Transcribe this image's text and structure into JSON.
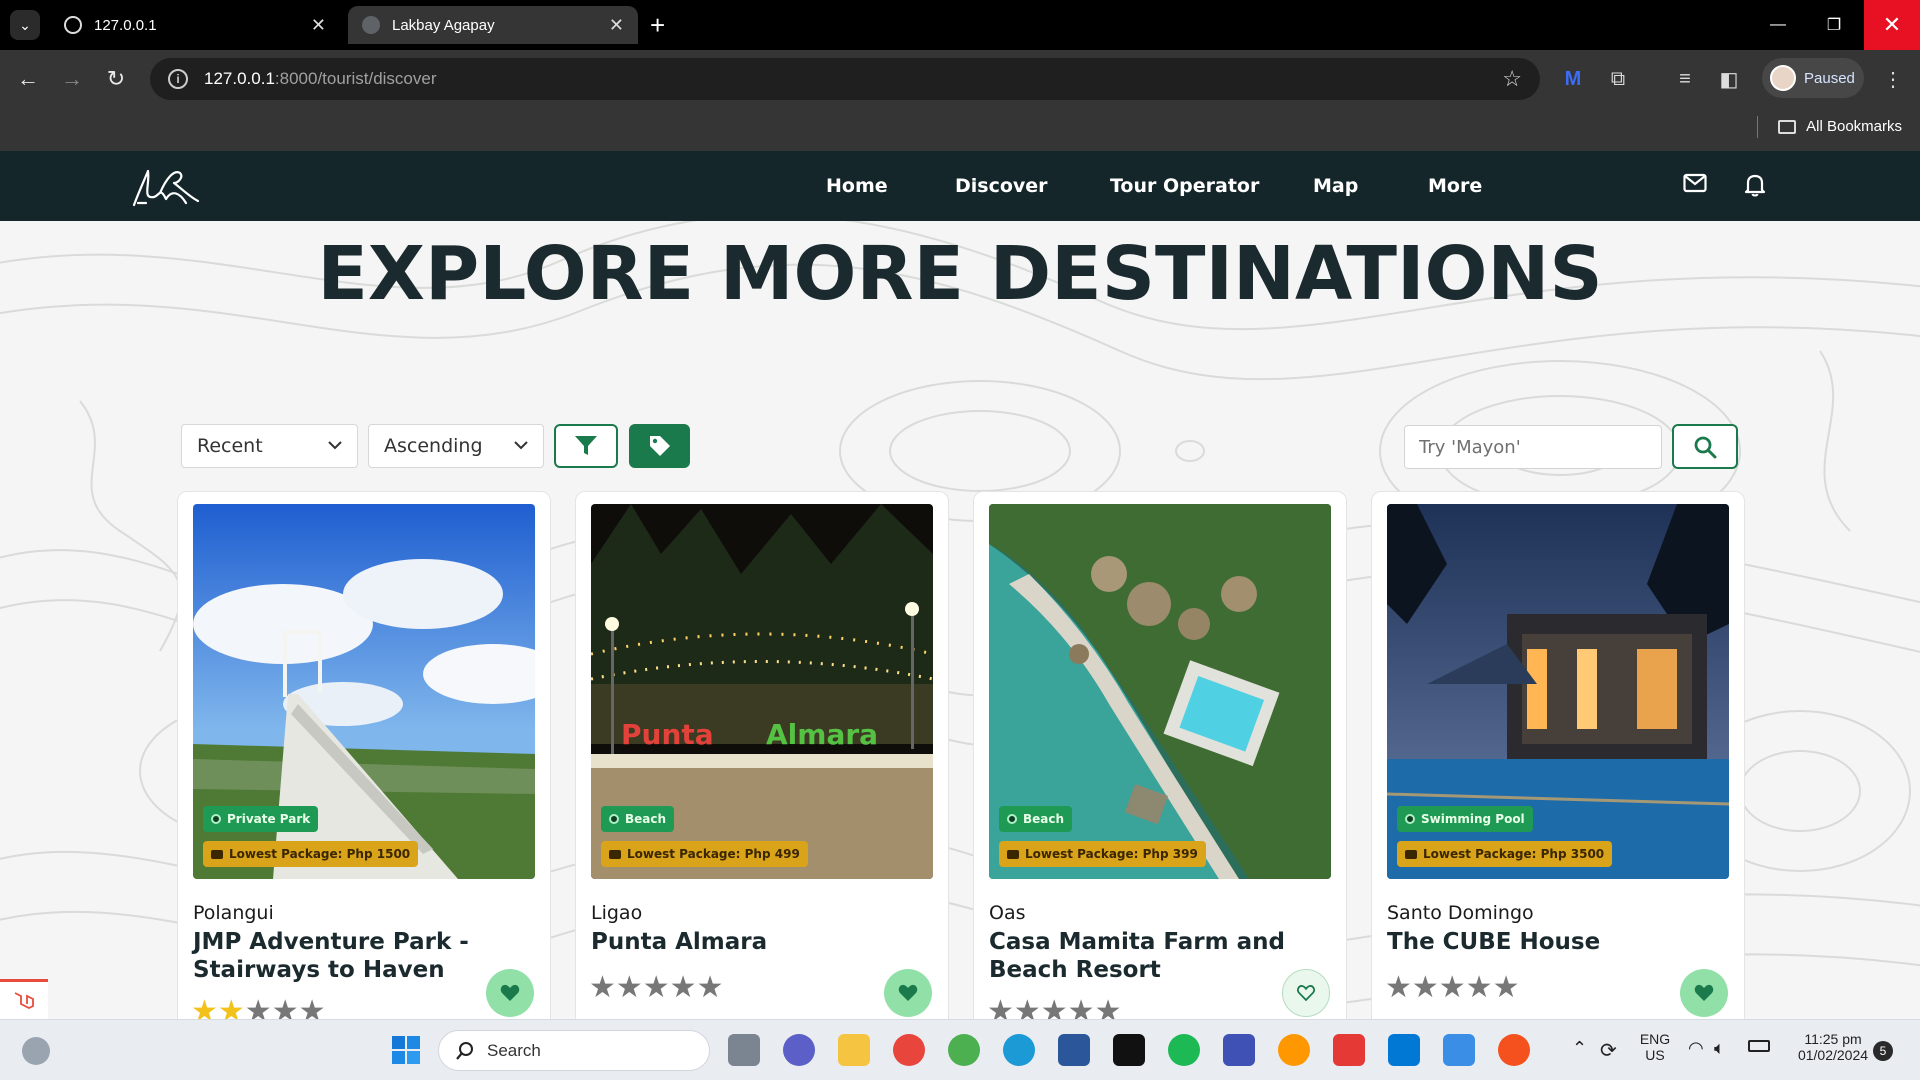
{
  "browser": {
    "tabs": [
      {
        "title": "127.0.0.1",
        "active": false
      },
      {
        "title": "Lakbay Agapay",
        "active": true
      }
    ],
    "url_host": "127.0.0.1",
    "url_path": ":8000/tourist/discover",
    "profile_label": "Paused",
    "bookmarks_label": "All Bookmarks"
  },
  "site": {
    "nav": [
      "Home",
      "Discover",
      "Tour Operator",
      "Map",
      "More"
    ],
    "hero_title": "EXPLORE MORE DESTINATIONS",
    "sort_field": "Recent",
    "sort_order": "Ascending",
    "search_placeholder": "Try 'Mayon'",
    "accent": "#1b7a4c",
    "nav_bg": "#15262a"
  },
  "cards": [
    {
      "town": "Polangui",
      "name": "JMP Adventure Park - Stairways to Haven",
      "category": "Private Park",
      "price": "Lowest Package: Php 1500",
      "rating": 2,
      "favorited": true
    },
    {
      "town": "Ligao",
      "name": "Punta Almara",
      "category": "Beach",
      "price": "Lowest Package: Php 499",
      "rating": 0,
      "favorited": true
    },
    {
      "town": "Oas",
      "name": "Casa Mamita Farm and Beach Resort",
      "category": "Beach",
      "price": "Lowest Package: Php 399",
      "rating": 0,
      "favorited": false
    },
    {
      "town": "Santo Domingo",
      "name": "The CUBE House",
      "category": "Swimming Pool",
      "price": "Lowest Package: Php 3500",
      "rating": 0,
      "favorited": true
    }
  ],
  "taskbar": {
    "search_label": "Search",
    "lang_top": "ENG",
    "lang_bottom": "US",
    "time": "11:25 pm",
    "date": "01/02/2024",
    "notif_count": "5"
  }
}
